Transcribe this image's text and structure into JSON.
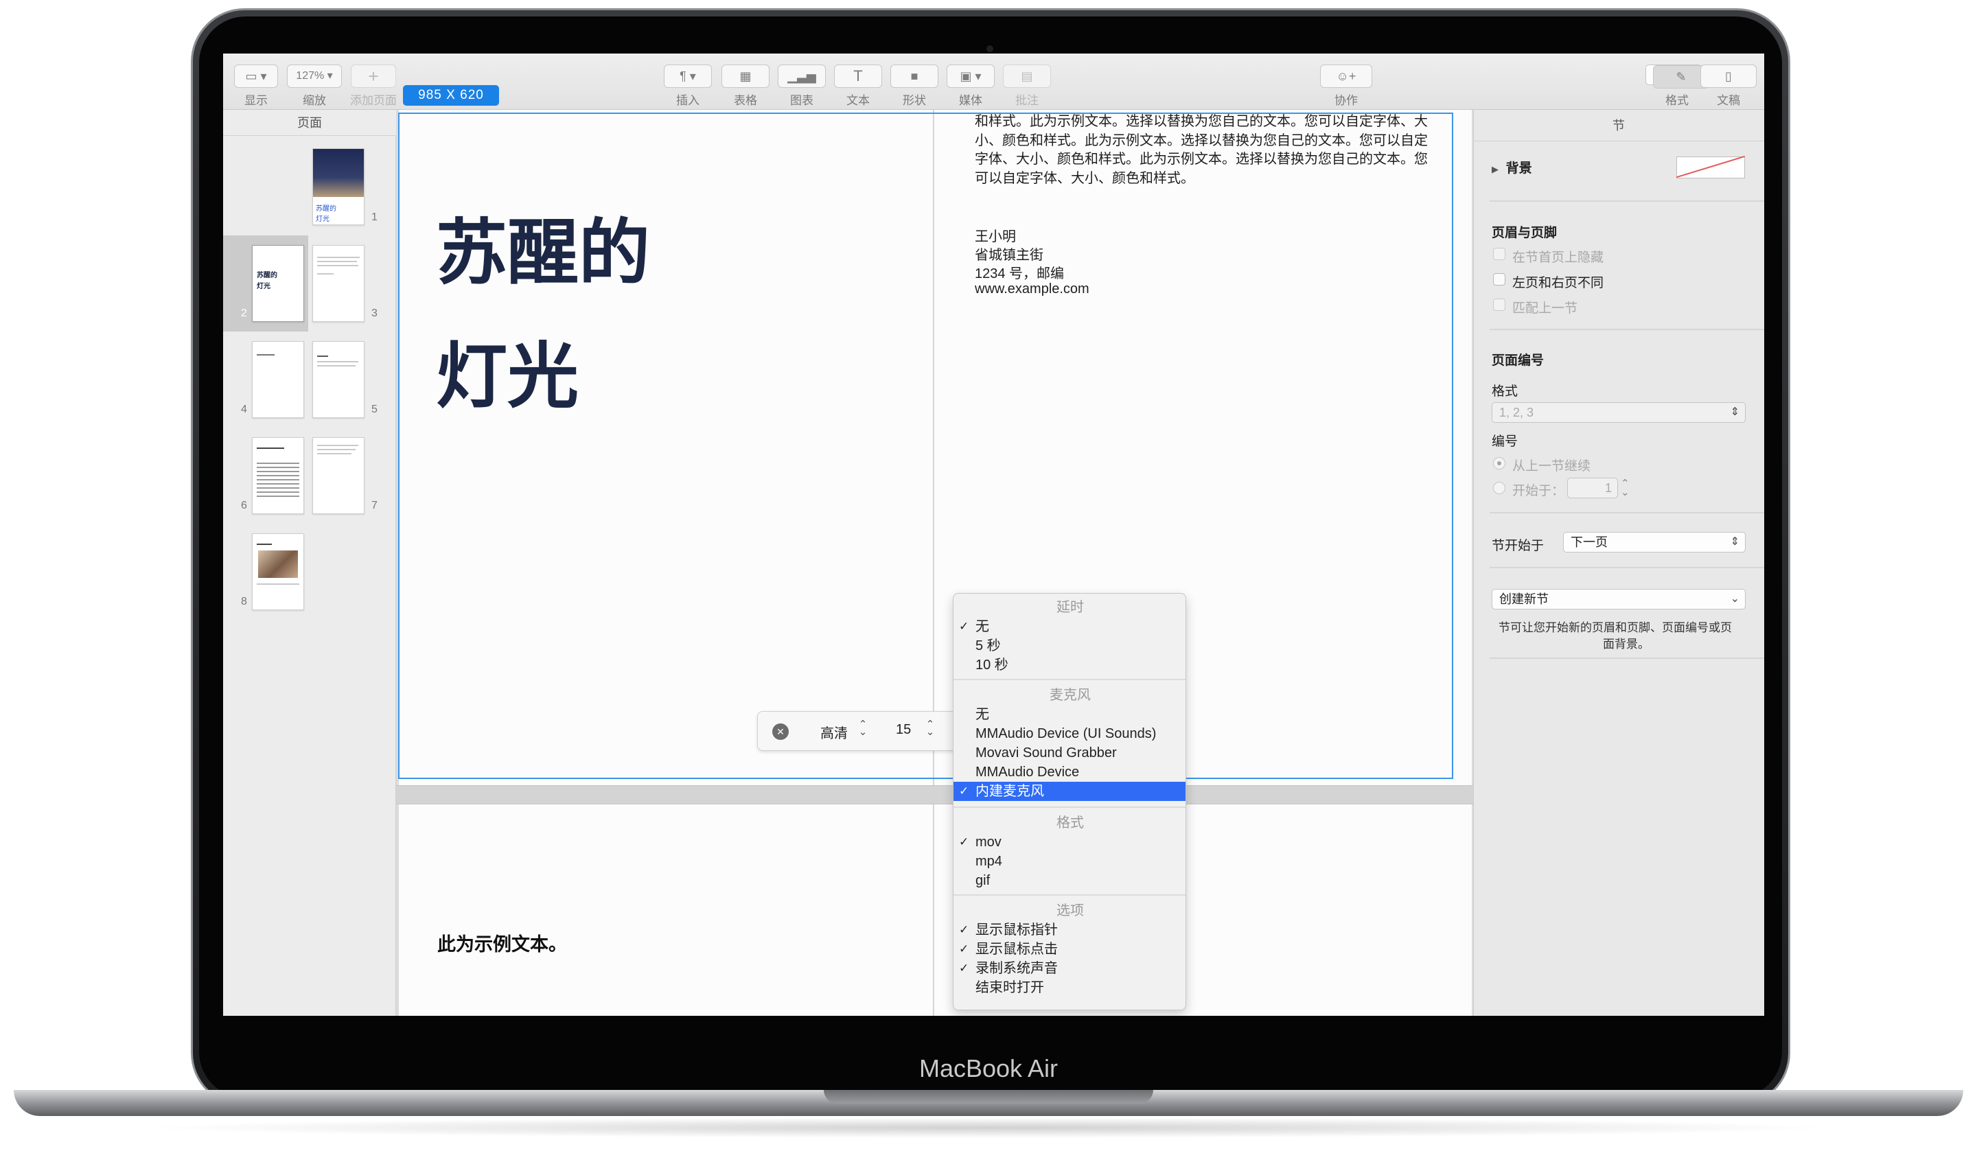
{
  "device": {
    "brand": "MacBook Air"
  },
  "toolbar": {
    "display": "显示",
    "zoom_value": "127%",
    "zoom": "缩放",
    "add_page": "添加页面",
    "insert": "插入",
    "table": "表格",
    "chart": "图表",
    "text": "文本",
    "shape": "形状",
    "media": "媒体",
    "comment": "批注",
    "collaborate": "协作",
    "format": "格式",
    "document": "文稿",
    "size_w": "985",
    "size_x": "X",
    "size_h": "620"
  },
  "sidebar": {
    "header": "页面",
    "page_numbers": [
      "1",
      "2",
      "3",
      "4",
      "5",
      "6",
      "7",
      "8"
    ],
    "thumb1_title": "苏醒的",
    "thumb1_title2": "灯光",
    "thumb2_title": "苏醒的",
    "thumb2_title2": "灯光"
  },
  "document": {
    "title_line1": "苏醒的",
    "title_line2": "灯光",
    "body_text": "和样式。此为示例文本。选择以替换为您自己的文本。您可以自定字体、大小、颜色和样式。此为示例文本。选择以替换为您自己的文本。您可以自定字体、大小、颜色和样式。此为示例文本。选择以替换为您自己的文本。您可以自定字体、大小、颜色和样式。",
    "address": [
      "王小明",
      "省城镇主街",
      "1234 号，邮编",
      "www.example.com"
    ],
    "sample_text": "此为示例文本。"
  },
  "recorder": {
    "quality": "高清",
    "fps": "15"
  },
  "menu": {
    "delay_header": "延时",
    "delay_items": [
      {
        "label": "无",
        "checked": true
      },
      {
        "label": "5 秒",
        "checked": false
      },
      {
        "label": "10 秒",
        "checked": false
      }
    ],
    "mic_header": "麦克风",
    "mic_items": [
      {
        "label": "无",
        "checked": false
      },
      {
        "label": "MMAudio Device (UI Sounds)",
        "checked": false
      },
      {
        "label": "Movavi Sound Grabber",
        "checked": false
      },
      {
        "label": "MMAudio Device",
        "checked": false
      },
      {
        "label": "内建麦克风",
        "checked": true
      }
    ],
    "format_header": "格式",
    "format_items": [
      {
        "label": "mov",
        "checked": true
      },
      {
        "label": "mp4",
        "checked": false
      },
      {
        "label": "gif",
        "checked": false
      }
    ],
    "options_header": "选项",
    "option_items": [
      {
        "label": "显示鼠标指针",
        "checked": true
      },
      {
        "label": "显示鼠标点击",
        "checked": true
      },
      {
        "label": "录制系统声音",
        "checked": true
      },
      {
        "label": "结束时打开",
        "checked": false
      }
    ],
    "check_glyph": "✓"
  },
  "inspector": {
    "header": "节",
    "background": "背景",
    "header_footer": "页眉与页脚",
    "hide_first": "在节首页上隐藏",
    "left_right_diff": "左页和右页不同",
    "match_prev": "匹配上一节",
    "page_numbering": "页面编号",
    "format_label": "格式",
    "format_value": "1, 2, 3",
    "numbering_label": "编号",
    "continue_prev": "从上一节继续",
    "start_at": "开始于：",
    "start_value": "1",
    "section_starts": "节开始于",
    "section_starts_value": "下一页",
    "create_section": "创建新节",
    "help_text_1": "节可让您开始新的页眉和页脚、页面编号或页",
    "help_text_2": "面背景。"
  },
  "colors": {
    "accent": "#1a82e6",
    "highlight": "#2f6bf5",
    "title": "#1b2744"
  }
}
